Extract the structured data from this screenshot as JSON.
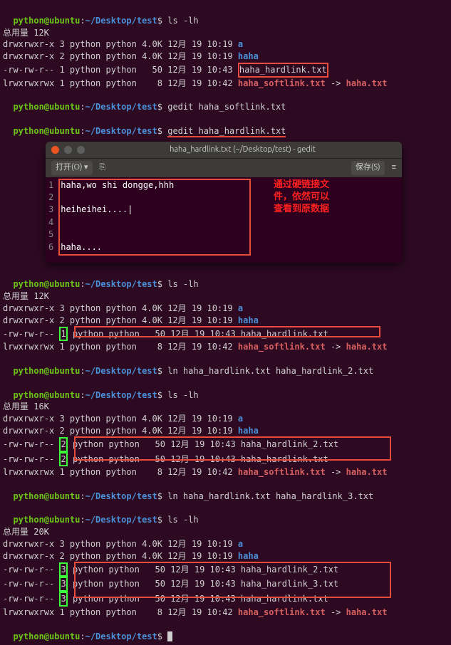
{
  "prompt": {
    "user_host": "python@ubuntu",
    "colon": ":",
    "path": "~/Desktop/test",
    "dollar": "$"
  },
  "block1": {
    "cmd1": "ls -lh",
    "total": "总用量 12K",
    "rows": [
      {
        "perm": "drwxrwxr-x 3 python python 4.0K 12月 19 10:19 ",
        "name": "a"
      },
      {
        "perm": "drwxrwxr-x 2 python python 4.0K 12月 19 10:19 ",
        "name": "haha"
      },
      {
        "perm": "-rw-rw-r-- 1 python python   50 12月 19 10:43 ",
        "name": "haha_hardlink.txt"
      },
      {
        "perm": "lrwxrwxrwx 1 python python    8 12月 19 10:42 ",
        "name": "haha_softlink.txt",
        "arrow": " -> ",
        "target": "haha.txt"
      }
    ],
    "cmd2": "gedit haha_softlink.txt",
    "cmd3": "gedit haha_hardlink.txt"
  },
  "gedit": {
    "title": "haha_hardlink.txt (~/Desktop/test) - gedit",
    "open_label": "打开(O)",
    "open_caret": "▾",
    "new_icon": "⎘",
    "save_label": "保存(S)",
    "burger": "≡",
    "lines": [
      "1",
      "2",
      "3",
      "4",
      "5",
      "6"
    ],
    "content": {
      "l1": "haha,wo shi  dongge,hhh",
      "l2": "",
      "l3": "heiheihei....|",
      "l4": "",
      "l5": "",
      "l6": "haha...."
    }
  },
  "annotation": {
    "line1": "通过硬链接文",
    "line2": "件，依然可以",
    "line3": "查看到原数据"
  },
  "block2": {
    "cmd1": "ls -lh",
    "total": "总用量 12K",
    "rows": [
      {
        "perm": "drwxrwxr-x 3 python python 4.0K 12月 19 10:19 ",
        "name": "a"
      },
      {
        "perm": "drwxrwxr-x 2 python python 4.0K 12月 19 10:19 ",
        "name": "haha"
      },
      {
        "perm_a": "-rw-rw-r-- ",
        "linkcnt": "1",
        "perm_b": " python python   50 12月 19 10:43 ",
        "name": "haha_hardlink.txt"
      },
      {
        "perm": "lrwxrwxrwx 1 python python    8 12月 19 10:42 ",
        "name": "haha_softlink.txt",
        "arrow": " -> ",
        "target": "haha.txt"
      }
    ],
    "cmd2": "ln haha_hardlink.txt haha_hardlink_2.txt",
    "cmd3": "ls -lh"
  },
  "block3": {
    "total": "总用量 16K",
    "rows": [
      {
        "perm": "drwxrwxr-x 3 python python 4.0K 12月 19 10:19 ",
        "name": "a"
      },
      {
        "perm": "drwxrwxr-x 2 python python 4.0K 12月 19 10:19 ",
        "name": "haha"
      },
      {
        "perm_a": "-rw-rw-r-- ",
        "linkcnt": "2",
        "perm_b": " python python   50 12月 19 10:43 ",
        "name": "haha_hardlink_2.txt"
      },
      {
        "perm_a": "-rw-rw-r-- ",
        "linkcnt": "2",
        "perm_b": " python python   50 12月 19 10:43 ",
        "name": "haha_hardlink.txt"
      },
      {
        "perm": "lrwxrwxrwx 1 python python    8 12月 19 10:42 ",
        "name": "haha_softlink.txt",
        "arrow": " -> ",
        "target": "haha.txt"
      }
    ],
    "cmd2": "ln haha_hardlink.txt haha_hardlink_3.txt",
    "cmd3": "ls -lh"
  },
  "block4": {
    "total": "总用量 20K",
    "rows": [
      {
        "perm": "drwxrwxr-x 3 python python 4.0K 12月 19 10:19 ",
        "name": "a"
      },
      {
        "perm": "drwxrwxr-x 2 python python 4.0K 12月 19 10:19 ",
        "name": "haha"
      },
      {
        "perm_a": "-rw-rw-r-- ",
        "linkcnt": "3",
        "perm_b": " python python   50 12月 19 10:43 ",
        "name": "haha_hardlink_2.txt"
      },
      {
        "perm_a": "-rw-rw-r-- ",
        "linkcnt": "3",
        "perm_b": " python python   50 12月 19 10:43 ",
        "name": "haha_hardlink_3.txt"
      },
      {
        "perm_a": "-rw-rw-r-- ",
        "linkcnt": "3",
        "perm_b": " python python   50 12月 19 10:43 ",
        "name": "haha_hardlink.txt"
      },
      {
        "perm": "lrwxrwxrwx 1 python python    8 12月 19 10:42 ",
        "name": "haha_softlink.txt",
        "arrow": " -> ",
        "target": "haha.txt"
      }
    ],
    "cmd_last": ""
  }
}
